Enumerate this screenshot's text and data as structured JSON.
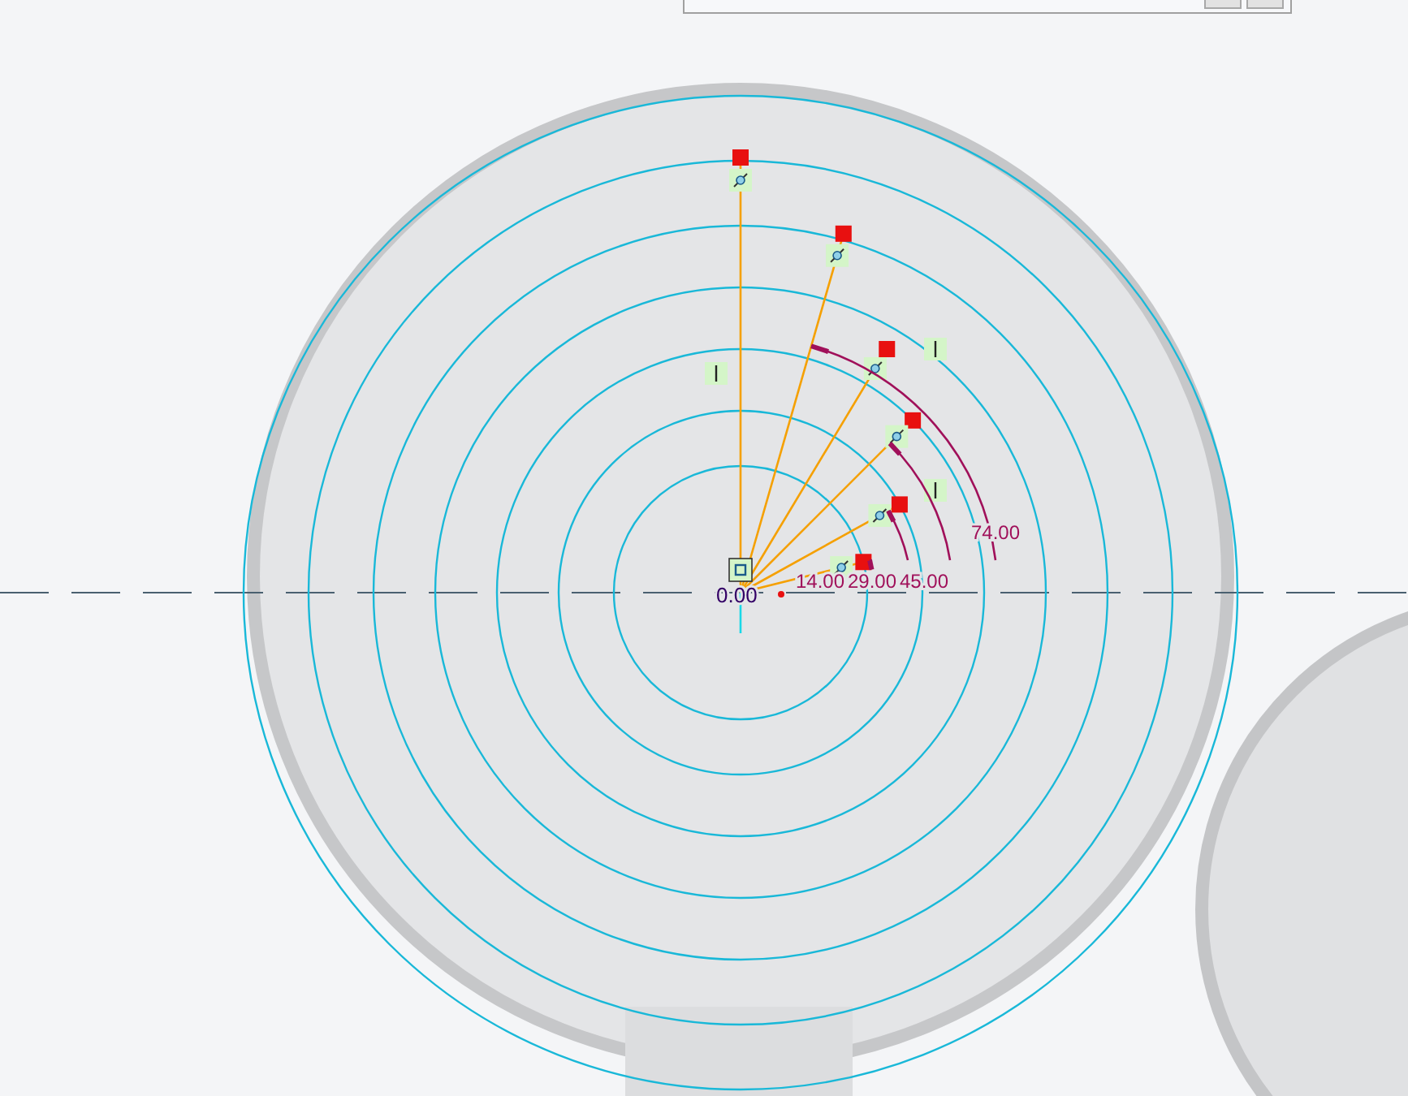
{
  "sketch": {
    "origin_dimension": "0.00",
    "angle_dimensions": [
      {
        "text": "14.00"
      },
      {
        "text": "29.00"
      },
      {
        "text": "45.00"
      },
      {
        "text": "74.00"
      }
    ]
  }
}
